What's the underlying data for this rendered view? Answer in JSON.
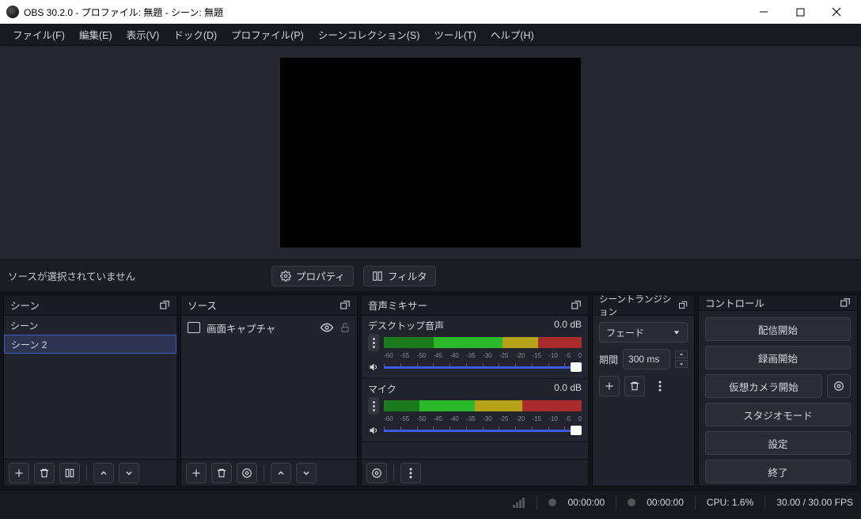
{
  "titlebar": {
    "title": "OBS 30.2.0 - プロファイル: 無題 - シーン: 無題"
  },
  "menubar": {
    "items": [
      {
        "label": "ファイル(F)"
      },
      {
        "label": "編集(E)"
      },
      {
        "label": "表示(V)"
      },
      {
        "label": "ドック(D)"
      },
      {
        "label": "プロファイル(P)"
      },
      {
        "label": "シーンコレクション(S)"
      },
      {
        "label": "ツール(T)"
      },
      {
        "label": "ヘルプ(H)"
      }
    ]
  },
  "source_toolbar": {
    "status": "ソースが選択されていません",
    "properties_label": "プロパティ",
    "filters_label": "フィルタ"
  },
  "docks": {
    "scenes": {
      "title": "シーン",
      "items": [
        {
          "name": "シーン"
        },
        {
          "name": "シーン 2"
        }
      ]
    },
    "sources": {
      "title": "ソース",
      "items": [
        {
          "name": "画面キャプチャ"
        }
      ]
    },
    "mixer": {
      "title": "音声ミキサー",
      "channels": [
        {
          "name": "デスクトップ音声",
          "level": "0.0 dB"
        },
        {
          "name": "マイク",
          "level": "0.0 dB"
        }
      ],
      "ticks": [
        "-60",
        "-55",
        "-50",
        "-45",
        "-40",
        "-35",
        "-30",
        "-25",
        "-20",
        "-15",
        "-10",
        "-5",
        "0"
      ]
    },
    "transitions": {
      "title": "シーントランジション",
      "selected": "フェード",
      "duration_label": "期間",
      "duration_value": "300 ms"
    },
    "controls": {
      "title": "コントロール",
      "buttons": {
        "stream": "配信開始",
        "record": "録画開始",
        "vcam": "仮想カメラ開始",
        "studio": "スタジオモード",
        "settings": "設定",
        "exit": "終了"
      }
    }
  },
  "statusbar": {
    "live_time": "00:00:00",
    "rec_time": "00:00:00",
    "cpu": "CPU: 1.6%",
    "fps": "30.00 / 30.00 FPS"
  }
}
